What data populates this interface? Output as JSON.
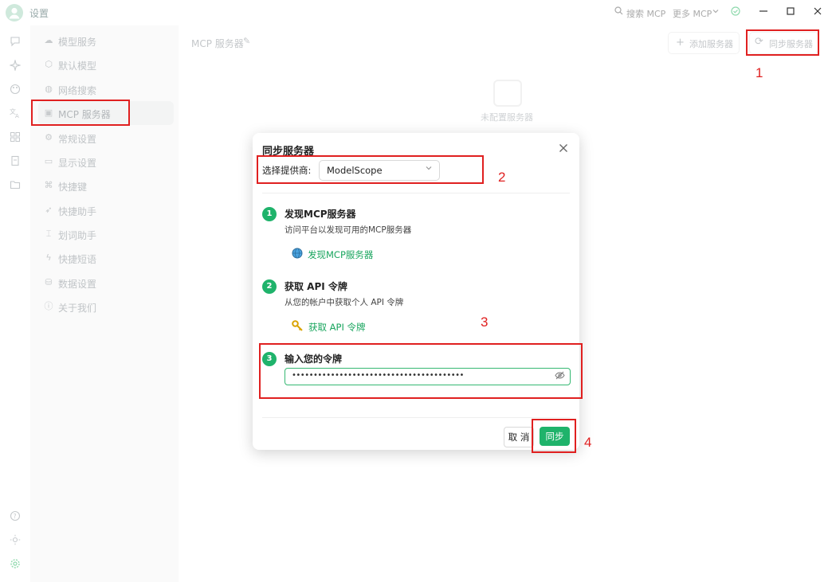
{
  "window": {
    "title": "设置",
    "search_mcp": "搜索 MCP",
    "more_mcp": "更多 MCP",
    "search_icon": "search-icon",
    "chevron_icon": "chevron-down-icon",
    "status_icon": "check-circle-icon",
    "minimize_icon": "minimize-icon",
    "maximize_icon": "maximize-icon",
    "close_icon": "close-icon"
  },
  "rail": {
    "icons": [
      "chat-icon",
      "sparkle-icon",
      "palette-icon",
      "translate-icon",
      "apps-icon",
      "files-icon",
      "folder-icon",
      "help-icon",
      "brightness-icon",
      "settings-icon"
    ]
  },
  "settings_menu": {
    "items": [
      {
        "label": "模型服务",
        "icon": "cloud-icon"
      },
      {
        "label": "默认模型",
        "icon": "cube-icon"
      },
      {
        "label": "网络搜索",
        "icon": "globe-icon"
      },
      {
        "label": "MCP 服务器",
        "icon": "terminal-icon"
      },
      {
        "label": "常规设置",
        "icon": "sliders-icon"
      },
      {
        "label": "显示设置",
        "icon": "monitor-icon"
      },
      {
        "label": "快捷键",
        "icon": "command-icon"
      },
      {
        "label": "快捷助手",
        "icon": "rocket-icon"
      },
      {
        "label": "划词助手",
        "icon": "text-select-icon"
      },
      {
        "label": "快捷短语",
        "icon": "zap-icon"
      },
      {
        "label": "数据设置",
        "icon": "database-icon"
      },
      {
        "label": "关于我们",
        "icon": "info-icon"
      }
    ],
    "active_index": 3
  },
  "main": {
    "title": "MCP 服务器",
    "add_server": "添加服务器",
    "sync_server": "同步服务器",
    "empty_text": "未配置服务器"
  },
  "modal": {
    "title": "同步服务器",
    "provider_label": "选择提供商:",
    "provider_value": "ModelScope",
    "steps": [
      {
        "num": "1",
        "title": "发现MCP服务器",
        "desc": "访问平台以发现可用的MCP服务器",
        "link": "发现MCP服务器",
        "link_icon": "globe-icon"
      },
      {
        "num": "2",
        "title": "获取 API 令牌",
        "desc": "从您的帐户中获取个人 API 令牌",
        "link": "获取 API 令牌",
        "link_icon": "key-icon"
      },
      {
        "num": "3",
        "title": "输入您的令牌"
      }
    ],
    "token_value": "••••••••••••••••••••••••••••••••••••••••",
    "cancel": "取 消",
    "sync": "同步"
  },
  "annotations": [
    "1",
    "2",
    "3",
    "4"
  ],
  "colors": {
    "accent": "#1fb36b",
    "annotation": "#e02020"
  }
}
